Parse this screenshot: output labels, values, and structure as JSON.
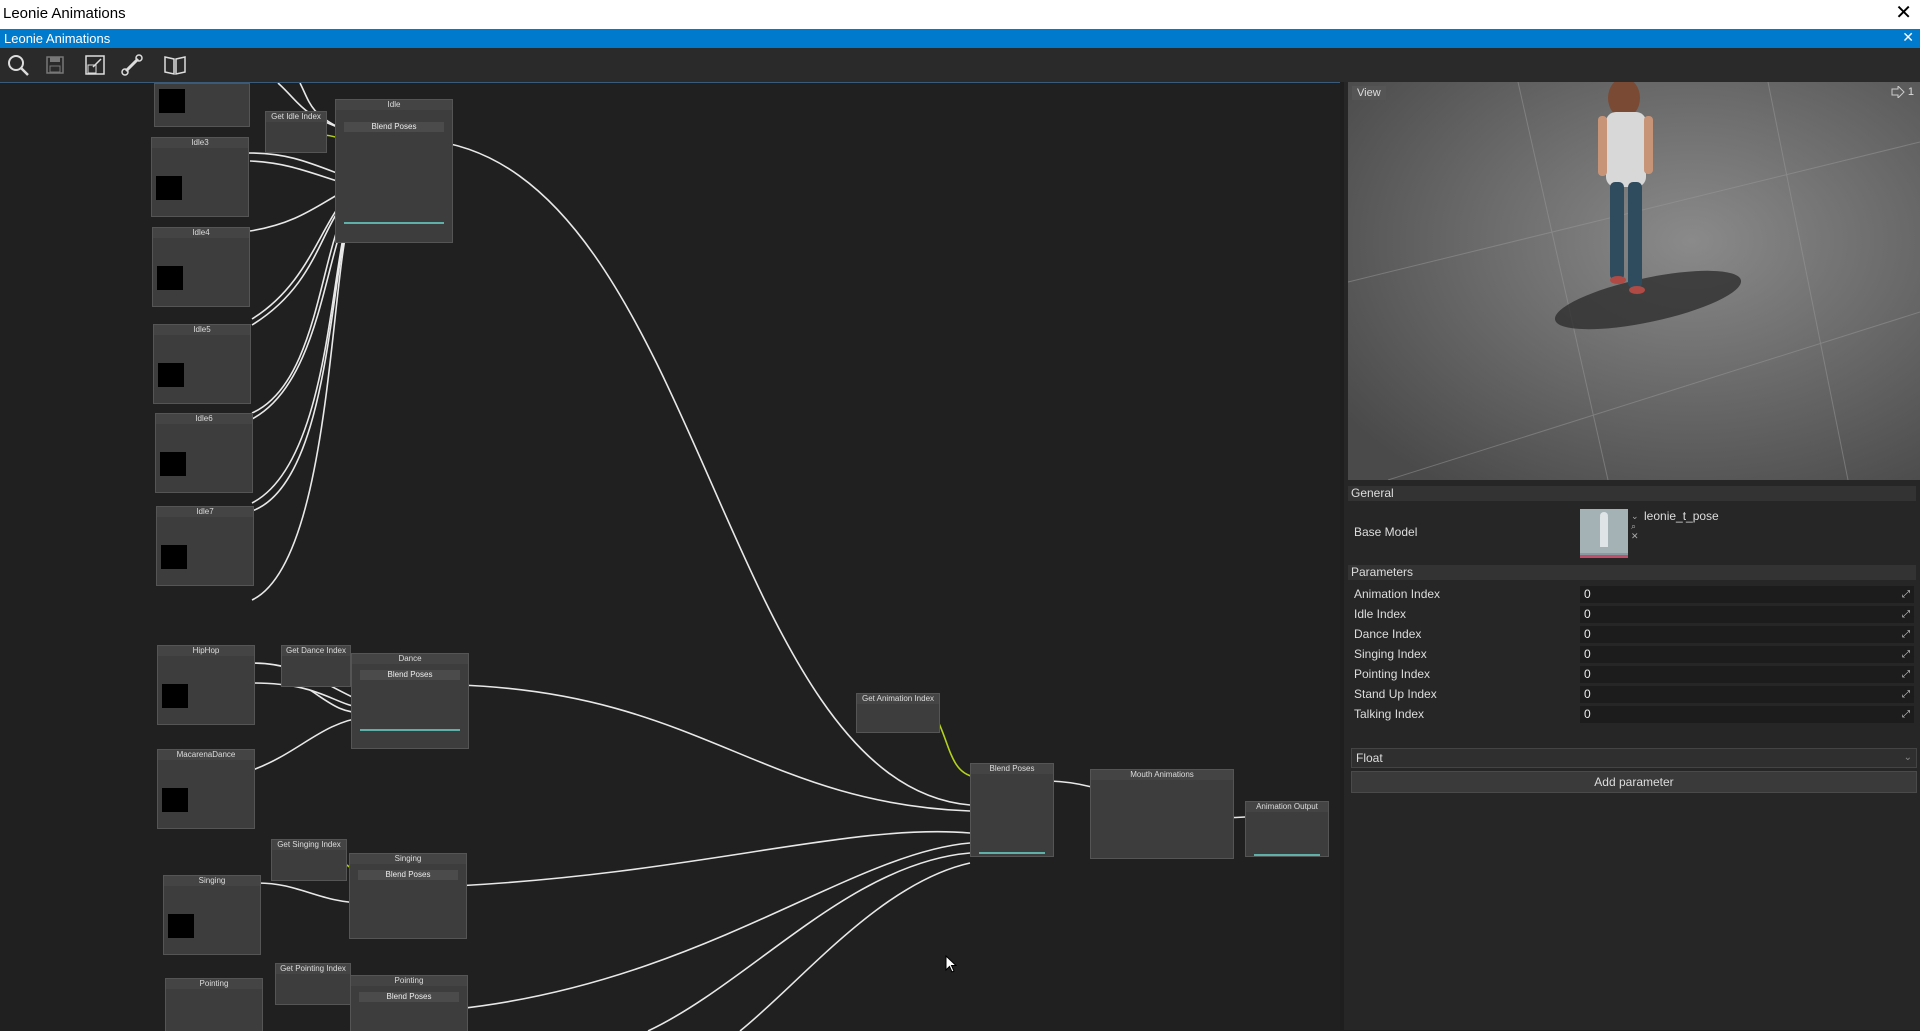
{
  "window": {
    "title": "Leonie Animations",
    "close": "✕"
  },
  "tab": {
    "title": "Leonie Animations",
    "close": "✕"
  },
  "toolbar": [
    {
      "icon": "search-icon"
    },
    {
      "icon": "save-icon"
    },
    {
      "icon": "export-icon"
    },
    {
      "icon": "bone-icon"
    },
    {
      "icon": "book-icon"
    }
  ],
  "graph": {
    "node_titles": {
      "idle": "Idle",
      "blend_idle": "Blend Poses",
      "get_idle_index": "Get Idle Index",
      "idle3": "Idle3",
      "idle4": "Idle4",
      "idle5": "Idle5",
      "idle6": "Idle6",
      "idle7": "Idle7",
      "hiphop": "HipHop",
      "macarena": "MacarenaDance",
      "get_dance_index": "Get Dance Index",
      "dance": "Dance",
      "blend_dance": "Blend Poses",
      "get_singing_index": "Get Singing Index",
      "singing_group": "Singing",
      "blend_singing": "Blend Poses",
      "singing_anim": "Singing",
      "get_pointing_index": "Get Pointing Index",
      "pointing_group": "Pointing",
      "blend_pointing": "Blend Poses",
      "pointing_anim": "Pointing",
      "get_animation_index": "Get Animation Index",
      "blend_main": "Blend Poses",
      "mouth": "Mouth Animations",
      "output": "Animation Output"
    }
  },
  "preview": {
    "label": "View",
    "counter": "1"
  },
  "general": {
    "header": "General",
    "base_model_label": "Base Model",
    "base_model_value": "leonie_t_pose"
  },
  "parameters": {
    "header": "Parameters",
    "items": [
      {
        "name": "Animation Index",
        "value": "0"
      },
      {
        "name": "Idle Index",
        "value": "0"
      },
      {
        "name": "Dance Index",
        "value": "0"
      },
      {
        "name": "Singing Index",
        "value": "0"
      },
      {
        "name": "Pointing Index",
        "value": "0"
      },
      {
        "name": "Stand Up Index",
        "value": "0"
      },
      {
        "name": "Talking Index",
        "value": "0"
      }
    ],
    "type_select": "Float",
    "add_label": "Add parameter"
  }
}
